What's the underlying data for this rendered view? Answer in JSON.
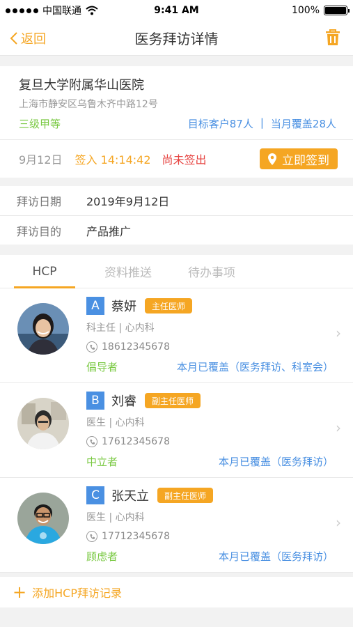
{
  "status_bar": {
    "carrier": "中国联通",
    "time": "9:41 AM",
    "battery": "100%",
    "battery_level": 1.0
  },
  "nav": {
    "back_label": "返回",
    "title": "医务拜访详情"
  },
  "hospital": {
    "name": "复旦大学附属华山医院",
    "address": "上海市静安区乌鲁木齐中路12号",
    "level": "三级甲等",
    "target_customers": "目标客户87人",
    "separator": "|",
    "month_coverage": "当月覆盖28人"
  },
  "signin": {
    "date": "9月12日",
    "sign_in": "签入 14:14:42",
    "sign_out_status": "尚未签出",
    "button_label": "立即签到"
  },
  "visit": {
    "date_label": "拜访日期",
    "date_value": "2019年9月12日",
    "purpose_label": "拜访目的",
    "purpose_value": "产品推广"
  },
  "tabs": [
    {
      "label": "HCP",
      "active": true
    },
    {
      "label": "资料推送",
      "active": false
    },
    {
      "label": "待办事项",
      "active": false
    }
  ],
  "hcps": [
    {
      "initial": "A",
      "name": "蔡妍",
      "title": "主任医师",
      "dept": "科主任 | 心内科",
      "phone": "18612345678",
      "tag": "倡导者",
      "coverage": "本月已覆盖（医务拜访、科室会）"
    },
    {
      "initial": "B",
      "name": "刘睿",
      "title": "副主任医师",
      "dept": "医生 | 心内科",
      "phone": "17612345678",
      "tag": "中立者",
      "coverage": "本月已覆盖（医务拜访）"
    },
    {
      "initial": "C",
      "name": "张天立",
      "title": "副主任医师",
      "dept": "医生 | 心内科",
      "phone": "17712345678",
      "tag": "顾虑者",
      "coverage": "本月已覆盖（医务拜访）"
    }
  ],
  "add_record": {
    "label": "添加HCP拜访记录"
  },
  "colors": {
    "accent": "#f5a623",
    "link_blue": "#4a90e2",
    "green": "#7ac943",
    "red": "#e64340"
  }
}
